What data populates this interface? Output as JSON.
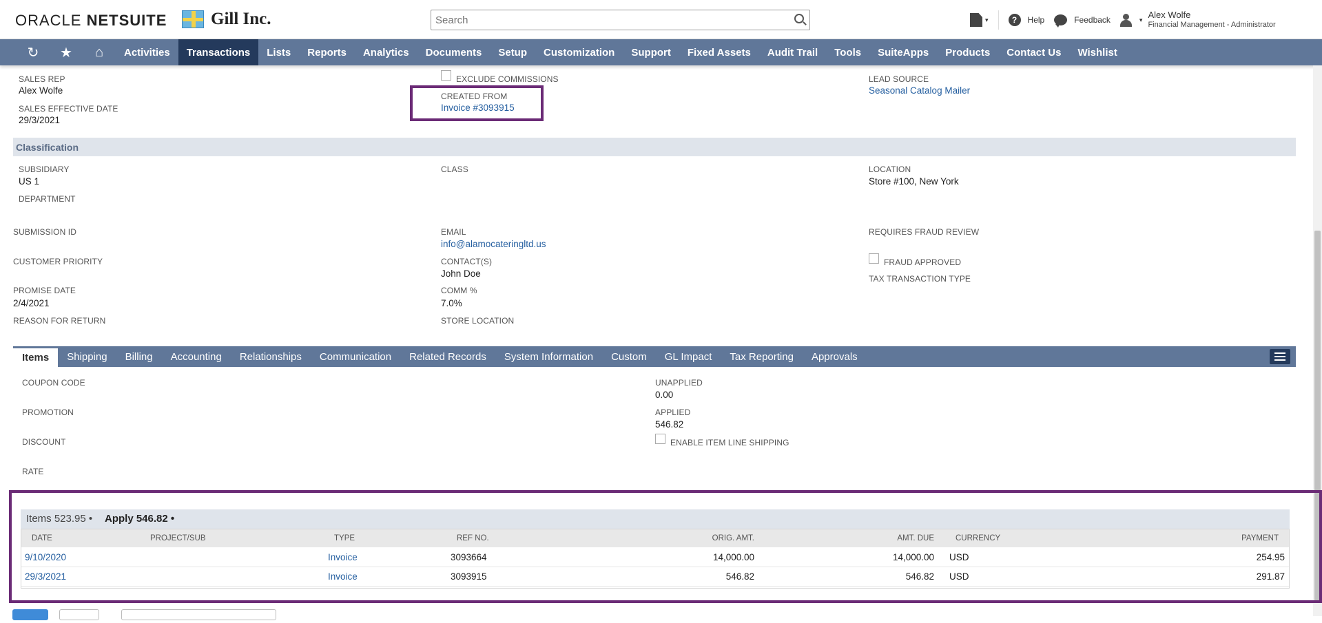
{
  "brand": {
    "oracle": "ORACLE",
    "netsuite": "NETSUITE",
    "company": "Gill Inc."
  },
  "search": {
    "placeholder": "Search"
  },
  "toolbar": {
    "help": "Help",
    "feedback": "Feedback",
    "user_name": "Alex Wolfe",
    "user_role": "Financial Management - Administrator"
  },
  "nav": {
    "items": [
      "Activities",
      "Transactions",
      "Lists",
      "Reports",
      "Analytics",
      "Documents",
      "Setup",
      "Customization",
      "Support",
      "Fixed Assets",
      "Audit Trail",
      "Tools",
      "SuiteApps",
      "Products",
      "Contact Us",
      "Wishlist"
    ],
    "active": "Transactions"
  },
  "fields": {
    "sales_rep_label": "SALES REP",
    "sales_rep": "Alex Wolfe",
    "sales_effective_date_label": "SALES EFFECTIVE DATE",
    "sales_effective_date": "29/3/2021",
    "exclude_commissions_label": "EXCLUDE COMMISSIONS",
    "created_from_label": "CREATED FROM",
    "created_from": "Invoice #3093915",
    "lead_source_label": "LEAD SOURCE",
    "lead_source": "Seasonal Catalog Mailer"
  },
  "classification": {
    "title": "Classification",
    "subsidiary_label": "SUBSIDIARY",
    "subsidiary": "US 1",
    "department_label": "DEPARTMENT",
    "class_label": "CLASS",
    "location_label": "LOCATION",
    "location": "Store #100, New York"
  },
  "other": {
    "submission_id_label": "SUBMISSION ID",
    "customer_priority_label": "CUSTOMER PRIORITY",
    "promise_date_label": "PROMISE DATE",
    "promise_date": "2/4/2021",
    "reason_for_return_label": "REASON FOR RETURN",
    "email_label": "EMAIL",
    "email": "info@alamocateringltd.us",
    "contacts_label": "CONTACT(S)",
    "contacts": "John Doe",
    "comm_label": "COMM %",
    "comm": "7.0%",
    "store_location_label": "STORE LOCATION",
    "requires_fraud_review_label": "REQUIRES FRAUD REVIEW",
    "fraud_approved_label": "FRAUD APPROVED",
    "tax_transaction_type_label": "TAX TRANSACTION TYPE"
  },
  "tabs": [
    "Items",
    "Shipping",
    "Billing",
    "Accounting",
    "Relationships",
    "Communication",
    "Related Records",
    "System Information",
    "Custom",
    "GL Impact",
    "Tax Reporting",
    "Approvals"
  ],
  "items_tab": {
    "coupon_code_label": "COUPON CODE",
    "promotion_label": "PROMOTION",
    "discount_label": "DISCOUNT",
    "rate_label": "RATE",
    "unapplied_label": "UNAPPLIED",
    "unapplied": "0.00",
    "applied_label": "APPLIED",
    "applied": "546.82",
    "enable_item_line_shipping_label": "ENABLE ITEM LINE SHIPPING"
  },
  "sublist": {
    "tab_items": "Items 523.95 •",
    "tab_apply": "Apply 546.82 •",
    "headers": {
      "date": "DATE",
      "project": "PROJECT/SUB",
      "type": "TYPE",
      "ref": "REF NO.",
      "orig": "ORIG. AMT.",
      "due": "AMT. DUE",
      "currency": "CURRENCY",
      "payment": "PAYMENT"
    },
    "rows": [
      {
        "date": "9/10/2020",
        "project": "",
        "type": "Invoice",
        "ref": "3093664",
        "orig": "14,000.00",
        "due": "14,000.00",
        "currency": "USD",
        "payment": "254.95"
      },
      {
        "date": "29/3/2021",
        "project": "",
        "type": "Invoice",
        "ref": "3093915",
        "orig": "546.82",
        "due": "546.82",
        "currency": "USD",
        "payment": "291.87"
      }
    ]
  }
}
